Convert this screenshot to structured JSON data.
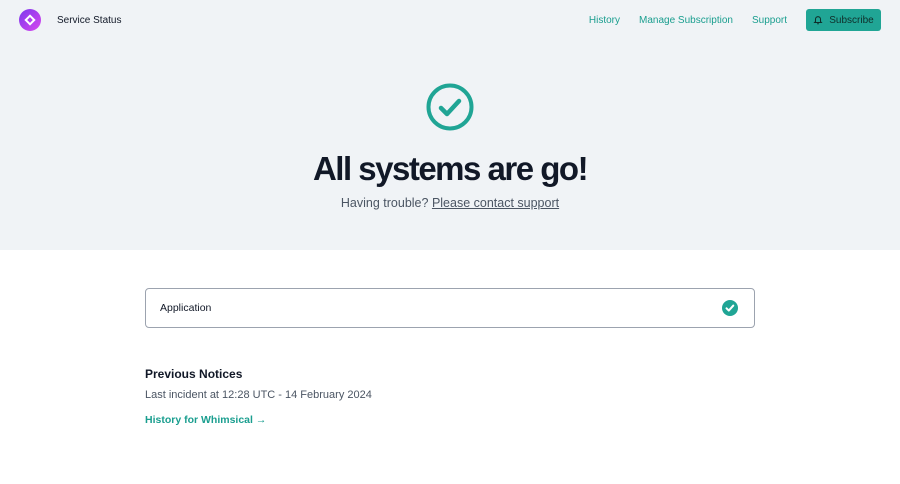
{
  "header": {
    "brand": "Service Status",
    "nav": [
      "History",
      "Manage Subscription",
      "Support"
    ],
    "subscribe": "Subscribe"
  },
  "hero": {
    "title": "All systems are go!",
    "trouble_prefix": "Having trouble?",
    "trouble_link": "Please contact support"
  },
  "components": [
    {
      "name": "Application",
      "status": "operational"
    }
  ],
  "notices": {
    "title": "Previous Notices",
    "last_incident": "Last incident at 12:28 UTC - 14 February 2024",
    "history_link": "History for Whimsical →"
  },
  "colors": {
    "accent": "#20a595"
  }
}
